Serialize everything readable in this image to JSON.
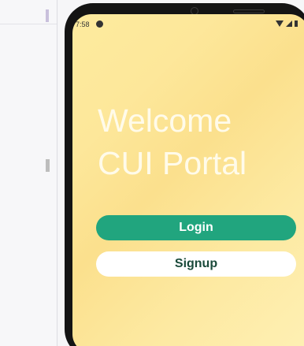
{
  "status_bar": {
    "time": "7:58",
    "icons": [
      "notification-dot-icon",
      "wifi-icon",
      "signal-icon",
      "battery-icon"
    ]
  },
  "welcome": {
    "line1": "Welcome",
    "line2": "CUI Portal"
  },
  "buttons": {
    "login_label": "Login",
    "signup_label": "Signup"
  },
  "colors": {
    "background_gradient_start": "#fdeb9e",
    "background_gradient_end": "#fef0b4",
    "login_button": "#21a57e",
    "signup_button": "#ffffff",
    "signup_text": "#1a4a3a",
    "title_text": "#fffbea"
  }
}
